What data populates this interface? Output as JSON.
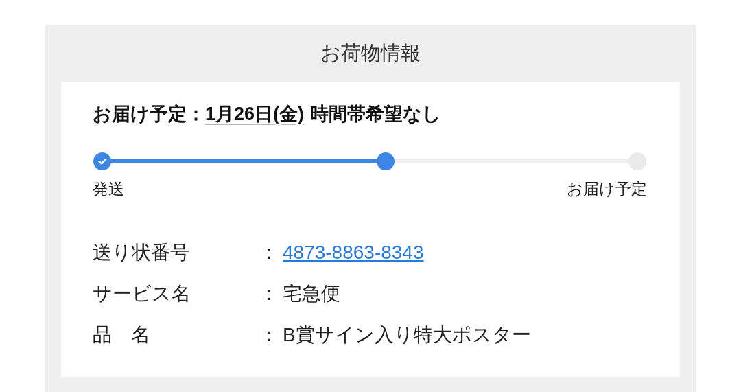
{
  "panel": {
    "title": "お荷物情報"
  },
  "delivery": {
    "label": "お届け予定：",
    "date": "1月26日(金)",
    "note": "時間帯希望なし"
  },
  "progress": {
    "level": 0.53,
    "steps": [
      {
        "label": "発送",
        "completed": true,
        "current": false
      },
      {
        "completed": false,
        "current": true
      },
      {
        "label": "お届け予定",
        "completed": false,
        "current": false
      }
    ]
  },
  "details": [
    {
      "label": "送り状番号",
      "separator": "：",
      "value": "4873-8863-8343",
      "kind": "link"
    },
    {
      "label": "サービス名",
      "separator": "：",
      "value": "宅急便",
      "kind": "text"
    },
    {
      "label": "品　名",
      "separator": "：",
      "value": "B賞サイン入り特大ポスター",
      "kind": "text"
    }
  ]
}
